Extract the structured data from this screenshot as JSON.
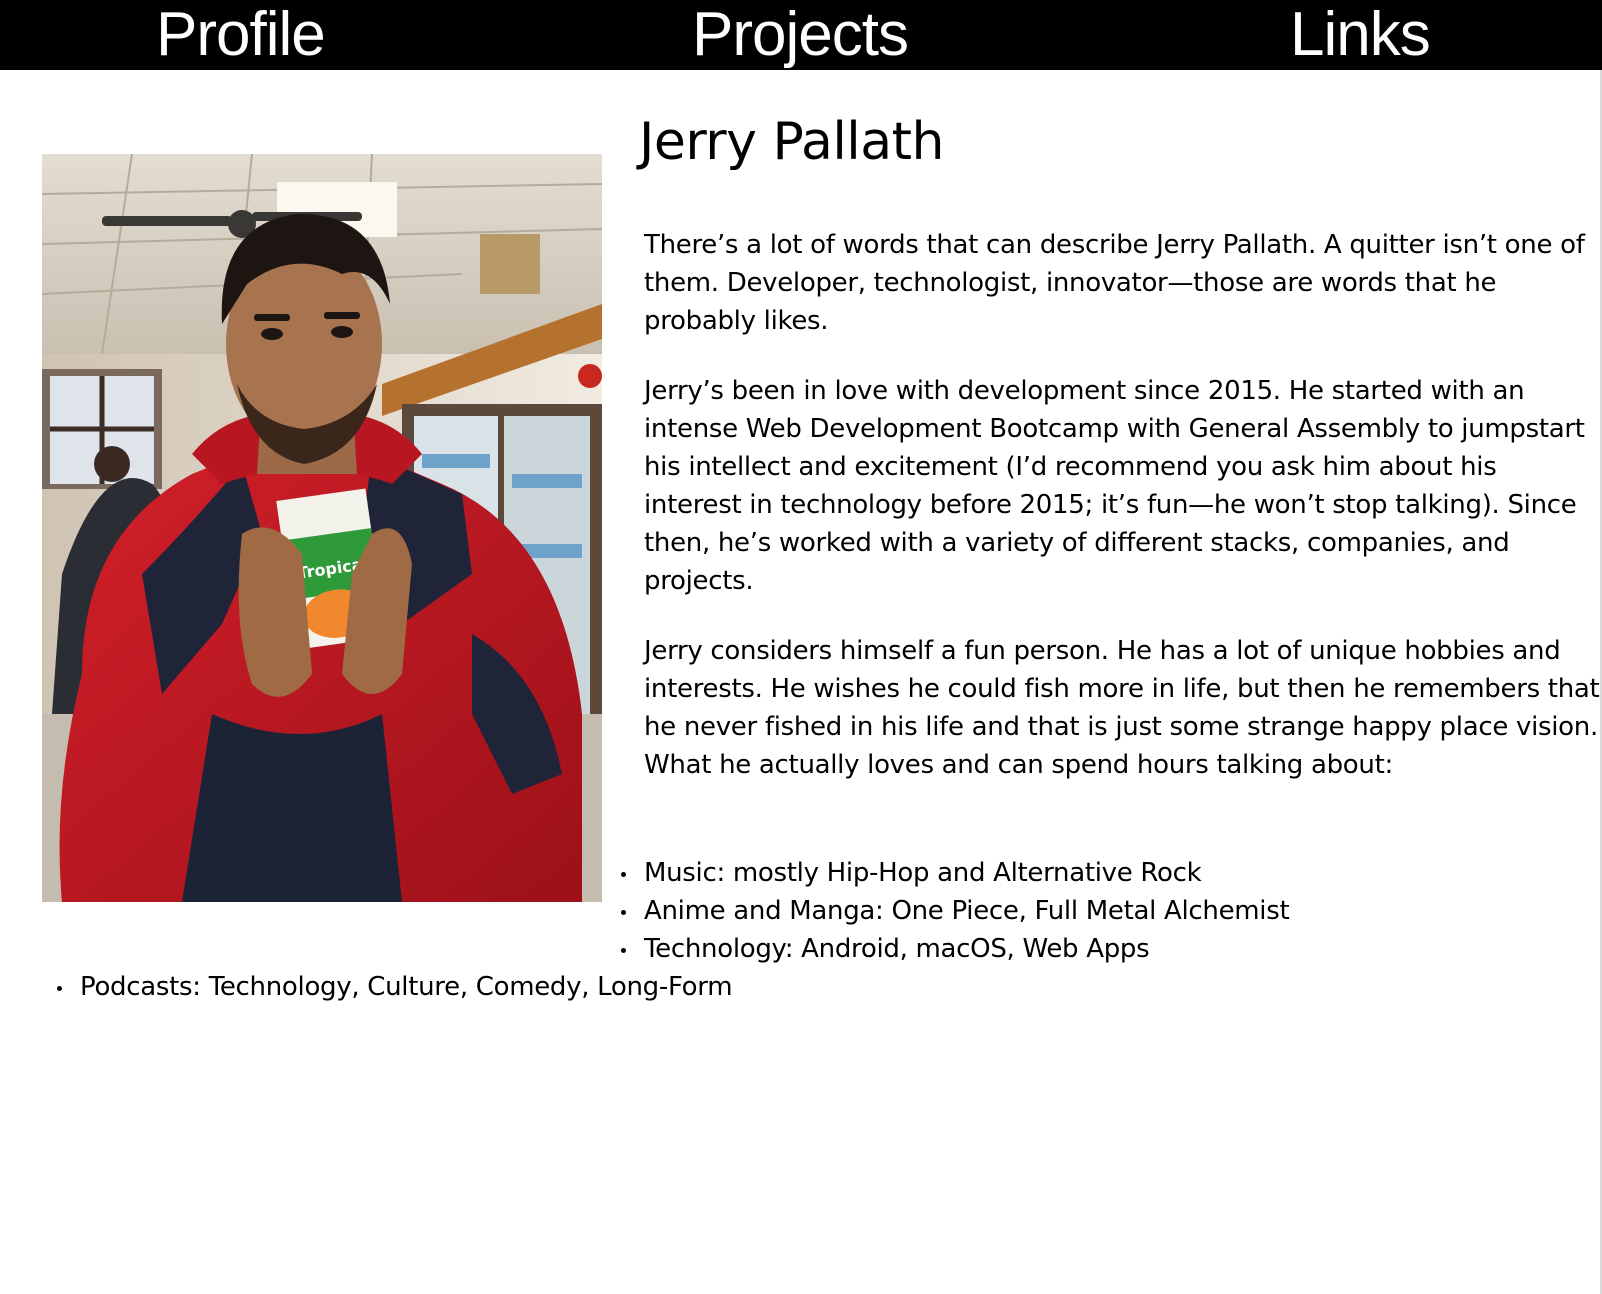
{
  "nav": {
    "profile": "Profile",
    "projects": "Projects",
    "links": "Links"
  },
  "profile": {
    "name": "Jerry Pallath",
    "photo_icon": "profile-photo",
    "paragraphs": [
      "There’s a lot of words that can describe Jerry Pallath. A quitter isn’t one of them. Developer, technologist, innovator—those are words that he probably likes.",
      "Jerry’s been in love with development since 2015. He started with an intense Web Development Bootcamp with General Assembly to jumpstart his intellect and excitement (I’d recommend you ask him about his interest in technology before 2015; it’s fun—he won’t stop talking). Since then, he’s worked with a variety of different stacks, companies, and projects.",
      "Jerry considers himself a fun person. He has a lot of unique hobbies and interests. He wishes he could fish more in life, but then he remembers that he never fished in his life and that is just some strange happy place vision. What he actually loves and can spend hours talking about:"
    ],
    "interests": [
      "Music: mostly Hip-Hop and Alternative Rock",
      "Anime and Manga: One Piece, Full Metal Alchemist",
      "Technology: Android, macOS, Web Apps",
      "Podcasts: Technology, Culture, Comedy, Long-Form"
    ]
  },
  "colors": {
    "nav_background": "#000000",
    "nav_text": "#ffffff",
    "body_text": "#000000",
    "background": "#ffffff"
  }
}
